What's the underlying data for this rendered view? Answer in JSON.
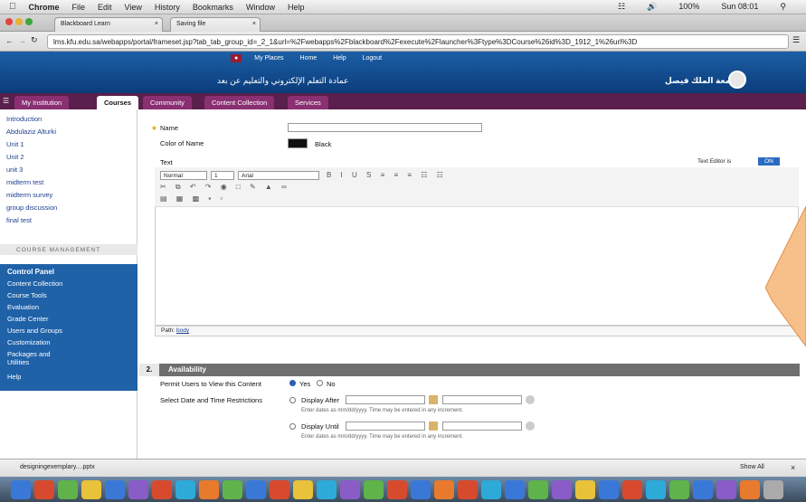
{
  "menubar": {
    "apple": "",
    "app": "Chrome",
    "items": [
      "File",
      "Edit",
      "View",
      "History",
      "Bookmarks",
      "Window",
      "Help"
    ],
    "status": {
      "battery": "100%",
      "clock": "Sun 08:01"
    }
  },
  "browser": {
    "tabs": [
      {
        "label": "Blackboard Learn"
      },
      {
        "label": "Saving file"
      }
    ],
    "url": "lms.kfu.edu.sa/webapps/portal/frameset.jsp?tab_tab_group_id=_2_1&url=%2Fwebapps%2Fblackboard%2Fexecute%2Flauncher%3Ftype%3DCourse%26id%3D_1912_1%26url%3D"
  },
  "bb": {
    "toplinks": [
      "My Places",
      "Home",
      "Help",
      "Logout"
    ],
    "university": "جامعة الملك فيصل",
    "portal": "عمادة التعلم الإلكتروني والتعليم عن بعد"
  },
  "navtabs": [
    "My Institution",
    "Courses",
    "Community",
    "Content Collection",
    "Services"
  ],
  "left": {
    "items": [
      "Introduction",
      "Abdulaziz Alturki",
      "Unit 1",
      "Unit 2",
      "unit 3",
      "midterm test",
      "midterm survey",
      "group discussion",
      "final test"
    ],
    "mgmt": "COURSE MANAGEMENT",
    "control": [
      "Control Panel",
      "Content Collection",
      "Course Tools",
      "Evaluation",
      "Grade Center",
      "Users and Groups",
      "Customization",
      "Packages and Utilities",
      "Help"
    ]
  },
  "form": {
    "name_label": "Name",
    "color_label": "Color of Name",
    "color_value": "Black",
    "text_label": "Text",
    "texteditor": "Text Editor is",
    "texteditor_state": "ON",
    "font_format": "Normal",
    "font_size": "1",
    "font_family": "Arial",
    "path_label": "Path:",
    "path_value": "body"
  },
  "availability": {
    "section_num": "2.",
    "title": "Availability",
    "permit_label": "Permit Users to View this Content",
    "yes": "Yes",
    "no": "No",
    "date_label": "Select Date and Time Restrictions",
    "after": "Display After",
    "until": "Display Until",
    "hint": "Enter dates as mm/dd/yyyy. Time may be entered in any increment."
  },
  "download": {
    "file": "designingexemplary....pptx",
    "showall": "Show All"
  },
  "colors": {
    "bb_blue": "#1c5fa6",
    "tab_purple": "#5a1f4c",
    "callout": "#f7c08a"
  }
}
